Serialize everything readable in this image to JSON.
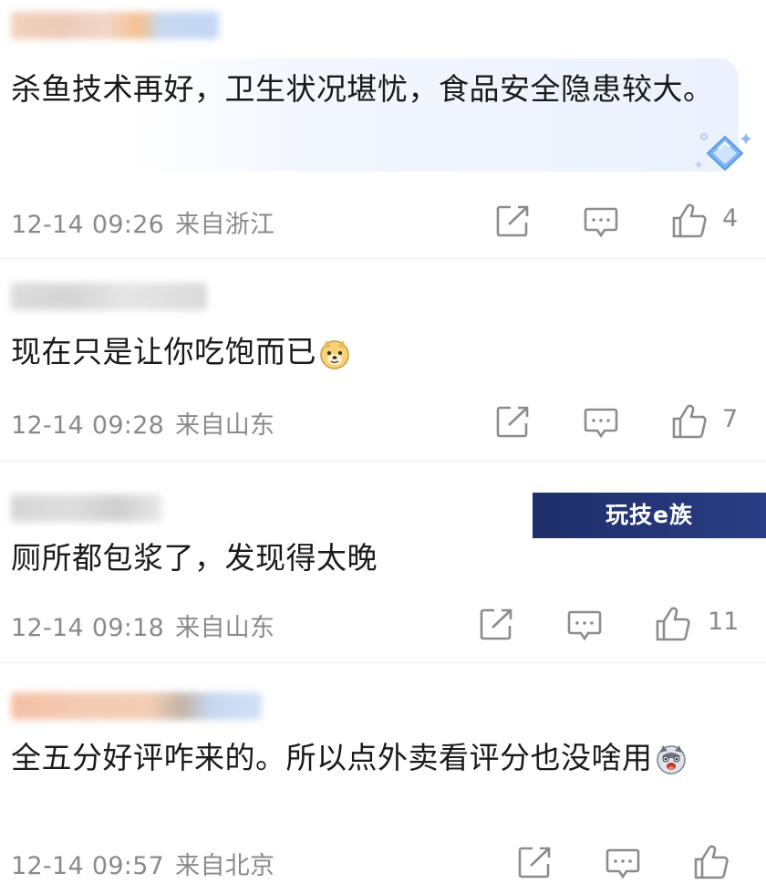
{
  "comments": [
    {
      "text": "杀鱼技术再好，卫生状况堪忧，食品安全隐患较大。",
      "date": "12-14 09:26",
      "location": "来自浙江",
      "likes": "4"
    },
    {
      "text": "现在只是让你吃饱而已",
      "emoji": "doge-emoji",
      "date": "12-14 09:28",
      "location": "来自山东",
      "likes": "7"
    },
    {
      "text": "厕所都包浆了，发现得太晚",
      "date": "12-14 09:18",
      "location": "来自山东",
      "likes": "11"
    },
    {
      "text": "全五分好评咋来的。所以点外卖看评分也没啥用",
      "emoji": "husky-emoji",
      "date": "12-14 09:57",
      "location": "来自北京",
      "likes": ""
    }
  ],
  "watermark": "玩技e族",
  "icons": {
    "share": "share-icon",
    "reply": "comment-icon",
    "like": "thumbs-up-icon",
    "badge": "diamond-badge-icon"
  },
  "colors": {
    "meta_text": "#8a8a8a",
    "icon_stroke": "#8c8c8c",
    "highlight_bg": "#ecf2fd",
    "banner_bg": "#24357a"
  }
}
